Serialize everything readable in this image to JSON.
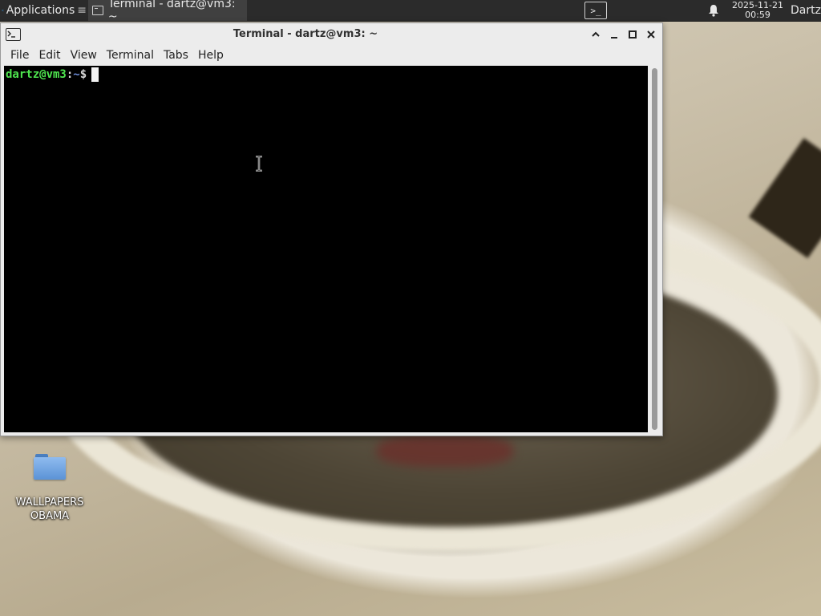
{
  "top_panel": {
    "applications_label": "Applications",
    "task_title": "Terminal - dartz@vm3: ~",
    "clock_date": "2025-11-21",
    "clock_time": "00:59",
    "user": "Dartz",
    "icons": {
      "applications": "xfce-logo-icon",
      "task": "terminal-icon",
      "launcher": "terminal-launcher-icon",
      "notifications": "bell-icon"
    }
  },
  "terminal": {
    "title": "Terminal - dartz@vm3: ~",
    "menu": [
      "File",
      "Edit",
      "View",
      "Terminal",
      "Tabs",
      "Help"
    ],
    "prompt": {
      "user_host": "dartz@vm3",
      "separator": ":",
      "path": "~",
      "symbol": "$"
    },
    "colors": {
      "background": "#000000",
      "prompt_user": "#4ee44e",
      "prompt_path": "#6f8fdc",
      "text": "#d8d8d8"
    }
  },
  "desktop": {
    "icons": [
      {
        "label": "WALLPAPERS\nOBAMA",
        "type": "folder"
      }
    ]
  }
}
